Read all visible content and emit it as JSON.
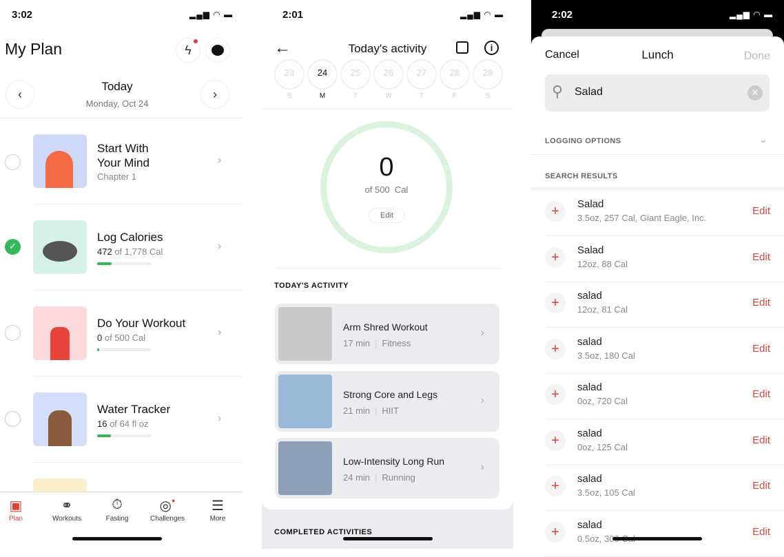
{
  "plan": {
    "time": "3:02",
    "title": "My Plan",
    "date_title": "Today",
    "date_sub": "Monday, Oct 24",
    "items": [
      {
        "title1": "Start With",
        "title2": "Your Mind",
        "sub": "Chapter 1",
        "done": false
      },
      {
        "title1": "Log Calories",
        "value": "472",
        "sub": " of 1,778 Cal",
        "done": true,
        "progress": 0.27
      },
      {
        "title1": "Do Your Workout",
        "value": "0",
        "sub": " of 500 Cal",
        "done": false,
        "progress": 0.02
      },
      {
        "title1": "Water Tracker",
        "value": "16",
        "sub": " of 64 fl oz",
        "done": false,
        "progress": 0.25
      }
    ],
    "tabs": [
      {
        "label": "Plan",
        "icon": "plan-icon"
      },
      {
        "label": "Workouts",
        "icon": "dumbbell-icon"
      },
      {
        "label": "Fasting",
        "icon": "stopwatch-icon"
      },
      {
        "label": "Challenges",
        "icon": "target-icon"
      },
      {
        "label": "More",
        "icon": "menu-icon"
      }
    ],
    "accent": "#d9443a",
    "green": "#35b85a"
  },
  "activity": {
    "time": "2:01",
    "title": "Today's activity",
    "days": [
      {
        "n": "23",
        "d": "S"
      },
      {
        "n": "24",
        "d": "M"
      },
      {
        "n": "25",
        "d": "T"
      },
      {
        "n": "26",
        "d": "W"
      },
      {
        "n": "27",
        "d": "T"
      },
      {
        "n": "28",
        "d": "F"
      },
      {
        "n": "29",
        "d": "S"
      }
    ],
    "selected_day": "24",
    "ring_value": "0",
    "ring_sub": "of 500  Cal",
    "edit": "Edit",
    "section": "TODAY'S ACTIVITY",
    "cards": [
      {
        "title": "Arm Shred Workout",
        "min": "17 min",
        "type": "Fitness"
      },
      {
        "title": "Strong Core and Legs",
        "min": "21 min",
        "type": "HIIT"
      },
      {
        "title": "Low-Intensity Long Run",
        "min": "24 min",
        "type": "Running"
      }
    ],
    "completed": "COMPLETED ACTIVITIES"
  },
  "lunch": {
    "time": "2:02",
    "cancel": "Cancel",
    "title": "Lunch",
    "done": "Done",
    "search": "Salad",
    "logging": "LOGGING OPTIONS",
    "results_label": "SEARCH RESULTS",
    "edit": "Edit",
    "results": [
      {
        "name": "Salad",
        "detail": "3.5oz, 257 Cal, Giant Eagle, Inc."
      },
      {
        "name": "Salad",
        "detail": "12oz, 88 Cal"
      },
      {
        "name": "salad",
        "detail": "12oz, 81 Cal"
      },
      {
        "name": "salad",
        "detail": "3.5oz, 180 Cal"
      },
      {
        "name": "salad",
        "detail": "0oz, 720 Cal"
      },
      {
        "name": "salad",
        "detail": "0oz, 125 Cal"
      },
      {
        "name": "salad",
        "detail": "3.5oz, 105 Cal"
      },
      {
        "name": "salad",
        "detail": "0.5oz, 300 Cal"
      }
    ]
  }
}
